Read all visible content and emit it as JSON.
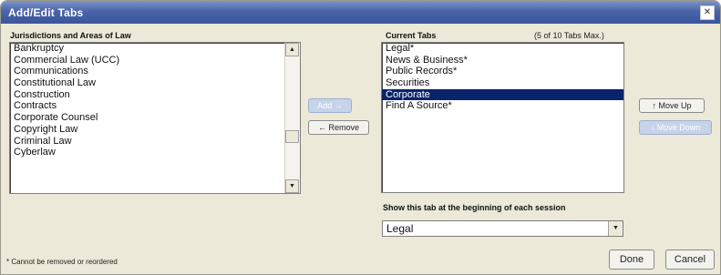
{
  "dialog": {
    "title": "Add/Edit Tabs",
    "close_glyph": "✕"
  },
  "jurisdictions": {
    "label": "Jurisdictions and Areas of Law",
    "items": [
      "Bankruptcy",
      "Commercial Law (UCC)",
      "Communications",
      "Constitutional Law",
      "Construction",
      "Contracts",
      "Corporate Counsel",
      "Copyright Law",
      "Criminal Law",
      "Cyberlaw"
    ]
  },
  "middle_buttons": {
    "add_label": "Add →",
    "remove_label": "← Remove"
  },
  "current_tabs": {
    "label": "Current Tabs",
    "count_note": "(5 of 10 Tabs Max.)",
    "items": [
      {
        "label": "Legal*",
        "selected": false
      },
      {
        "label": "News & Business*",
        "selected": false
      },
      {
        "label": "Public Records*",
        "selected": false
      },
      {
        "label": "Securities",
        "selected": false
      },
      {
        "label": "Corporate",
        "selected": true
      },
      {
        "label": "Find A Source*",
        "selected": false
      }
    ]
  },
  "right_buttons": {
    "move_up_label": "↑ Move Up",
    "move_down_label": "↓ Move Down"
  },
  "start_tab": {
    "label": "Show this tab at the beginning of each session",
    "selected_value": "Legal"
  },
  "footer": {
    "note": "* Cannot be removed or reordered",
    "done_label": "Done",
    "cancel_label": "Cancel"
  },
  "colors": {
    "titlebar": "#3a559e",
    "selection": "#0a246a",
    "dialog_bg": "#ece9d8"
  },
  "icons": {
    "scroll_up": "up-arrow-icon",
    "scroll_down": "down-arrow-icon",
    "dropdown": "chevron-down-icon"
  }
}
